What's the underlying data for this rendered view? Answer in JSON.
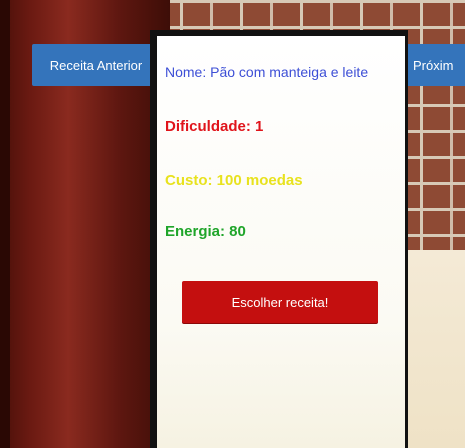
{
  "recipe": {
    "name": "Nome: Pão com manteiga e leite",
    "difficulty": "Dificuldade: 1",
    "cost": "Custo: 100 moedas",
    "energy": "Energia: 80"
  },
  "buttons": {
    "previous": "Receita Anterior",
    "next": "Próxim",
    "choose": "Escolher receita!"
  },
  "colors": {
    "name_text": "#3d4fd6",
    "difficulty_text": "#e0141b",
    "cost_text": "#e8e21e",
    "energy_text": "#1fa52a",
    "nav_button": "#3474bb",
    "choose_button": "#c40f0f"
  }
}
